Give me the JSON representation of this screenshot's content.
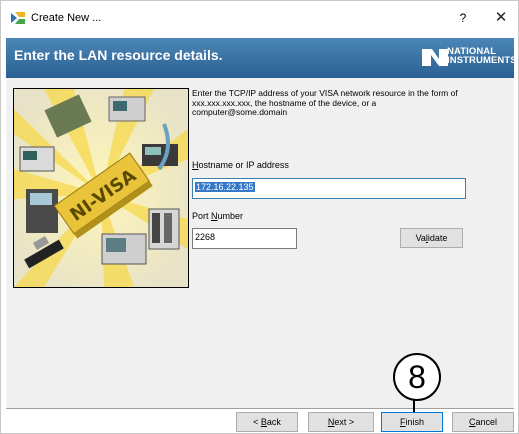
{
  "window": {
    "title": "Create New ...",
    "help_label": "?",
    "close_label": "✕"
  },
  "banner": {
    "heading": "Enter the LAN resource details.",
    "logo_line1": "NATIONAL",
    "logo_line2": "INSTRUMENTS"
  },
  "art": {
    "ni_visa_text": "NI-VISA"
  },
  "form": {
    "instructions": "Enter the TCP/IP address of your VISA network resource in the form of xxx.xxx.xxx.xxx, the hostname of the device, or a computer@some.domain",
    "host_label_pre": "",
    "host_label_accel": "H",
    "host_label_post": "ostname or IP address",
    "host_value": "172.16.22.135",
    "port_label_pre": "Port ",
    "port_label_accel": "N",
    "port_label_post": "umber",
    "port_value": "2268",
    "validate_pre": "Va",
    "validate_accel": "l",
    "validate_post": "idate"
  },
  "buttons": {
    "back_pre": "< ",
    "back_accel": "B",
    "back_post": "ack",
    "next_accel": "N",
    "next_post": "ext >",
    "finish_accel": "F",
    "finish_post": "inish",
    "cancel_accel": "C",
    "cancel_post": "ancel"
  },
  "annotation": {
    "step_number": "8"
  },
  "colors": {
    "banner_top": "#4b86b6",
    "banner_bottom": "#2b6093",
    "selection": "#3578c7",
    "default_button_border": "#0078d7"
  }
}
